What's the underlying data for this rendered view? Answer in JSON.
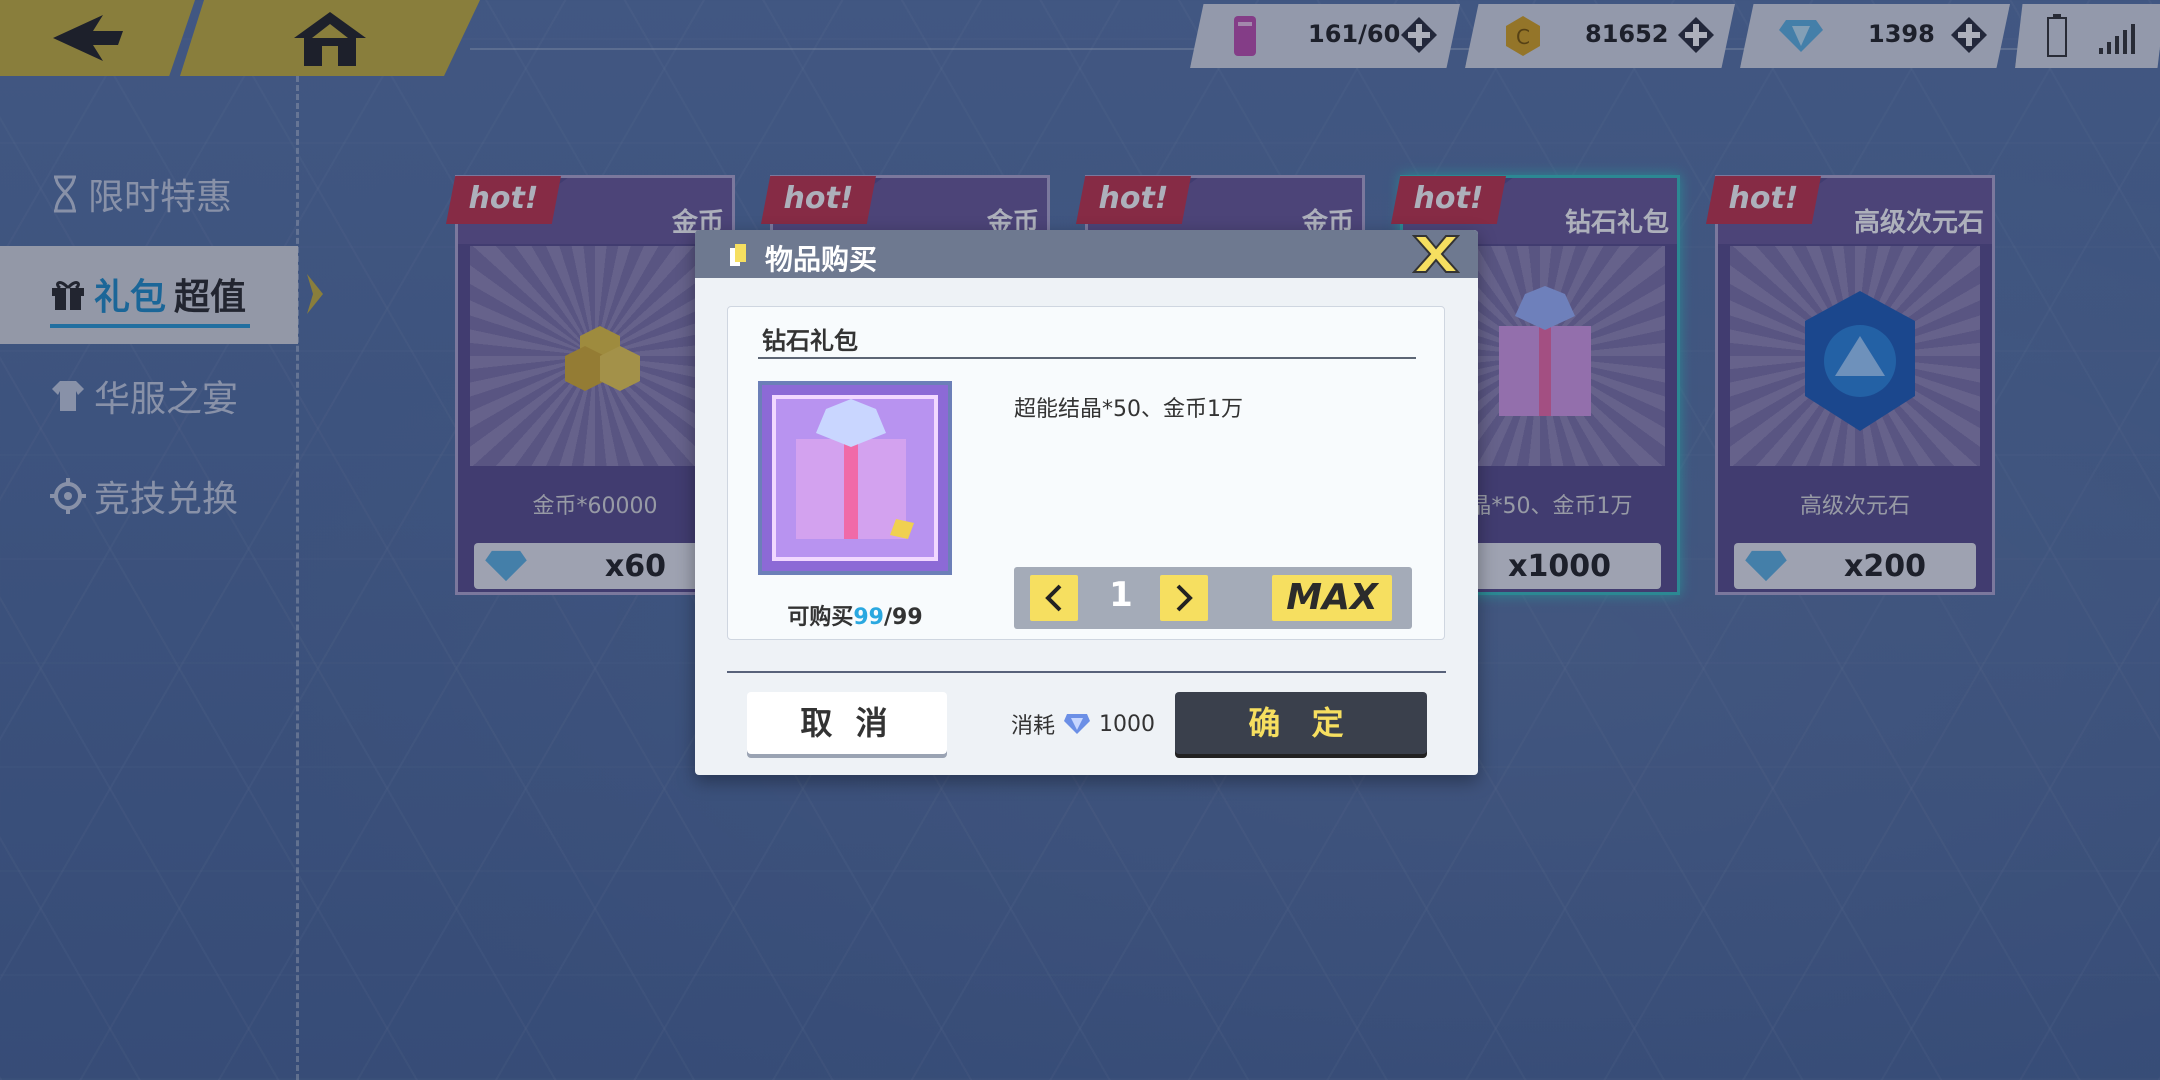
{
  "topbar": {
    "back_icon": "back-arrow-icon",
    "home_icon": "home-icon",
    "resources": [
      {
        "icon": "stamina-icon",
        "value": "161/60"
      },
      {
        "icon": "coin-icon",
        "value": "81652"
      },
      {
        "icon": "diamond-icon",
        "value": "1398"
      }
    ]
  },
  "sidebar": {
    "items": [
      {
        "label": "限时特惠",
        "icon": "hourglass-icon"
      },
      {
        "label_a": "礼包",
        "label_b": "超值",
        "icon": "gift-icon"
      },
      {
        "label": "华服之宴",
        "icon": "shirt-icon"
      },
      {
        "label": "竞技兑换",
        "icon": "gear-icon"
      }
    ]
  },
  "cards": [
    {
      "hot": "hot!",
      "title": "金币",
      "desc": "金币*60000",
      "price": "x60"
    },
    {
      "hot": "hot!",
      "title": "金币"
    },
    {
      "hot": "hot!",
      "title": "金币"
    },
    {
      "hot": "hot!",
      "title": "钻石礼包",
      "desc": "结晶*50、金币1万",
      "price": "x1000"
    },
    {
      "hot": "hot!",
      "title": "高级次元石",
      "desc": "高级次元石",
      "price": "x200"
    }
  ],
  "dialog": {
    "title": "物品购买",
    "item_name": "钻石礼包",
    "item_desc": "超能结晶*50、金币1万",
    "stock_prefix": "可购买",
    "stock_current": "99",
    "stock_sep_total": "/99",
    "quantity": "1",
    "max_label": "MAX",
    "cancel_label": "取 消",
    "cost_label": "消耗",
    "cost_value": "1000",
    "confirm_label": "确 定"
  },
  "colors": {
    "accent_yellow": "#f6df60",
    "hot_red": "#c4334a",
    "highlight_blue": "#2aa8e0"
  }
}
